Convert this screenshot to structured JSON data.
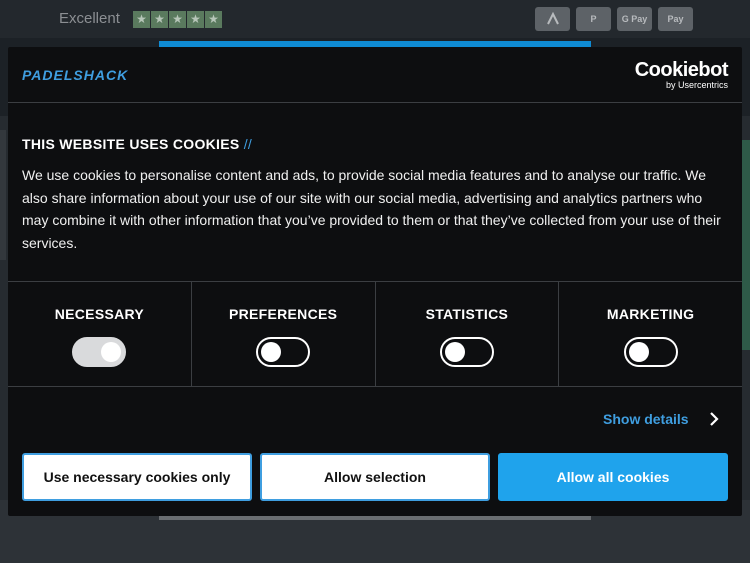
{
  "trustbar": {
    "rating_label": "Excellent",
    "star_count": 5,
    "payments": [
      "afterpay-icon",
      "paypal-icon",
      "google-pay-icon",
      "apple-pay-icon"
    ],
    "payment_labels": [
      "",
      "P",
      "G Pay",
      "Pay"
    ]
  },
  "modal": {
    "brand": "PADELSHACK",
    "cookiebot": {
      "name": "Cookiebot",
      "byline": "by Usercentrics"
    },
    "title": "THIS WEBSITE USES COOKIES",
    "title_suffix": "//",
    "description": "We use cookies to personalise content and ads, to provide social media features and to analyse our traffic. We also share information about your use of our site with our social media, advertising and analytics partners who may combine it with other information that you’ve provided to them or that they’ve collected from your use of their services.",
    "categories": [
      {
        "label": "NECESSARY",
        "enabled": true,
        "locked": true
      },
      {
        "label": "PREFERENCES",
        "enabled": false
      },
      {
        "label": "STATISTICS",
        "enabled": false
      },
      {
        "label": "MARKETING",
        "enabled": false
      }
    ],
    "show_details": "Show details",
    "buttons": {
      "necessary_only": "Use necessary cookies only",
      "allow_selection": "Allow selection",
      "allow_all": "Allow all cookies"
    }
  },
  "colors": {
    "accent": "#3f9ee0",
    "primary_button": "#1fa3ec",
    "modal_bg": "#0d0e10"
  }
}
